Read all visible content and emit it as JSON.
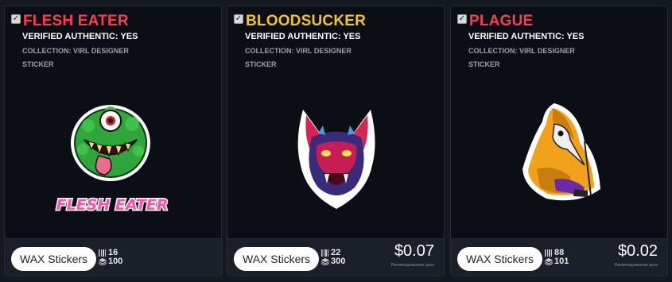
{
  "cards": [
    {
      "title": "FLESH EATER",
      "title_color": "#ff3b4f",
      "verified": "VERIFIED AUTHENTIC: YES",
      "collection": "COLLECTION: VIRL DESIGNER STICKER",
      "art_label": "FLESH EATER",
      "art_icon": "green-monster-sticker",
      "button": "WAX Stickers",
      "mint": "16",
      "supply": "100",
      "price": "",
      "price_note": ""
    },
    {
      "title": "BLOODSUCKER",
      "title_color": "#f5c518",
      "verified": "VERIFIED AUTHENTIC: YES",
      "collection": "COLLECTION: VIRL DESIGNER STICKER",
      "art_icon": "vampire-bat-sticker",
      "button": "WAX Stickers",
      "mint": "22",
      "supply": "300",
      "price": "$0.07",
      "price_note": "Рекомендованная цена"
    },
    {
      "title": "PLAGUE",
      "title_color": "#ff3b4f",
      "verified": "VERIFIED AUTHENTIC: YES",
      "collection": "COLLECTION: VIRL DESIGNER STICKER",
      "art_icon": "plague-doctor-sticker",
      "button": "WAX Stickers",
      "mint": "88",
      "supply": "101",
      "price": "$0.02",
      "price_note": "Рекомендованная цена"
    }
  ]
}
